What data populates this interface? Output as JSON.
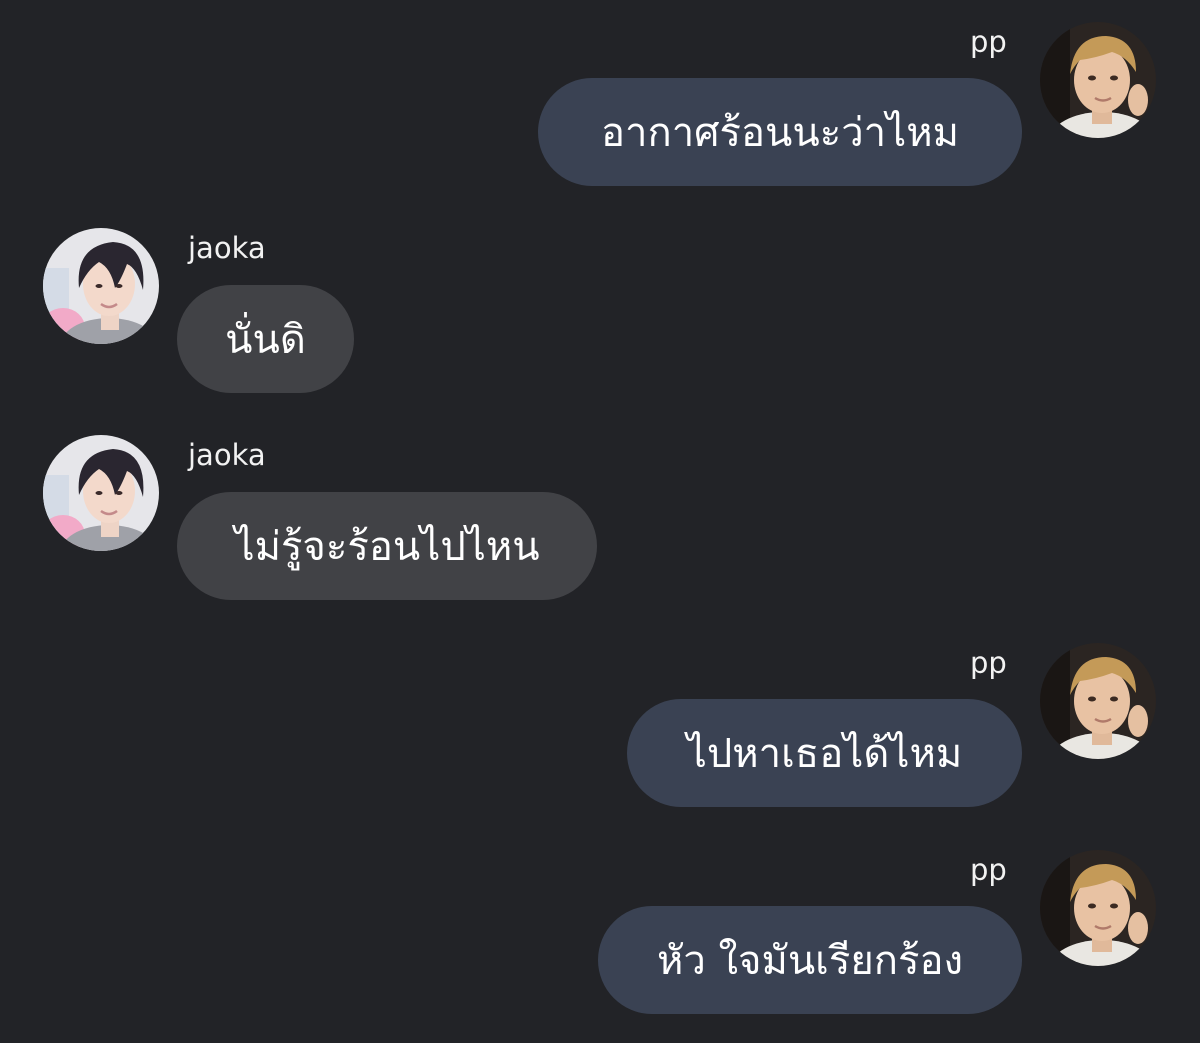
{
  "chat": {
    "messages": [
      {
        "sender": "pp",
        "direction": "outgoing",
        "text": "อากาศร้อนนะว่าไหม",
        "avatar_icon": "user-avatar-pp"
      },
      {
        "sender": "jaoka",
        "direction": "incoming",
        "text": "นั่นดิ",
        "avatar_icon": "user-avatar-jaoka"
      },
      {
        "sender": "jaoka",
        "direction": "incoming",
        "text": "ไม่รู้จะร้อนไปไหน",
        "avatar_icon": "user-avatar-jaoka"
      },
      {
        "sender": "pp",
        "direction": "outgoing",
        "text": "ไปหาเธอได้ไหม",
        "avatar_icon": "user-avatar-pp"
      },
      {
        "sender": "pp",
        "direction": "outgoing",
        "text": "หัว ใจมันเรียกร้อง",
        "avatar_icon": "user-avatar-pp"
      }
    ]
  },
  "colors": {
    "background": "#222327",
    "outgoing_bubble": "#3a4253",
    "incoming_bubble": "#414246",
    "text": "#ffffff"
  }
}
